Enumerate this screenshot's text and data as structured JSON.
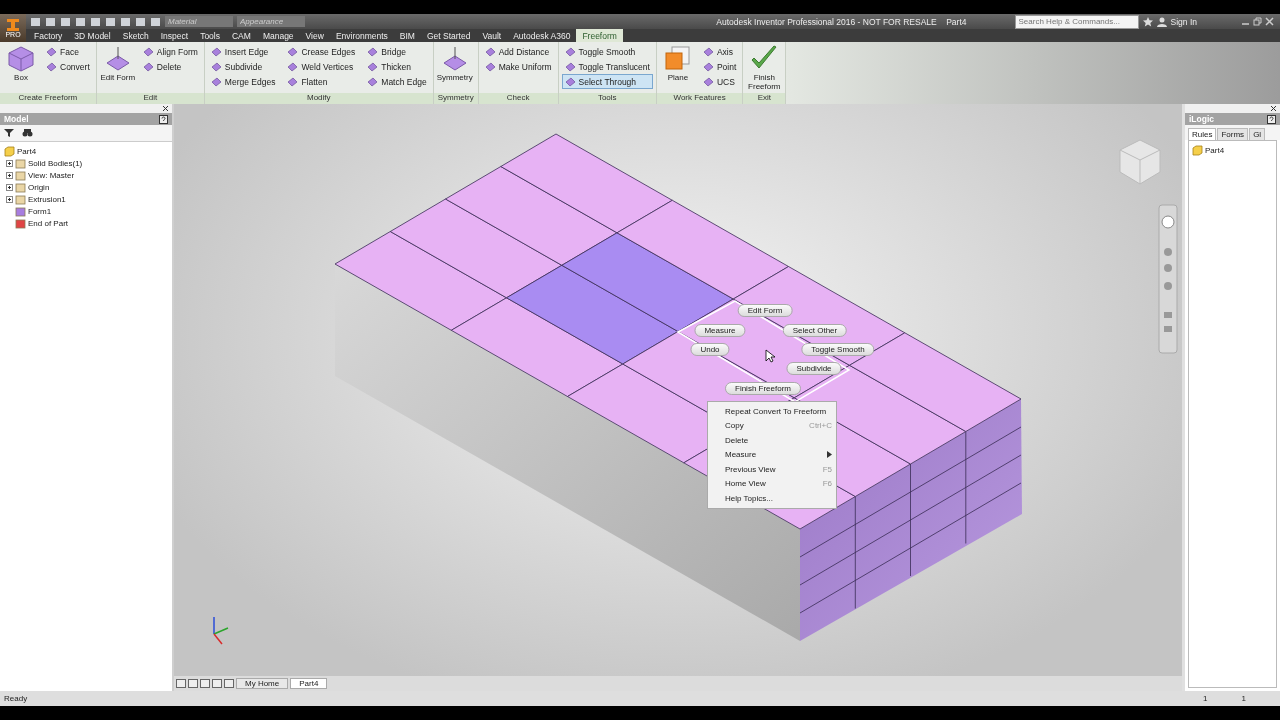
{
  "title_bar": {
    "app_badge": "PRO",
    "material": {
      "placeholder": "Material"
    },
    "appearance": {
      "placeholder": "Appearance"
    },
    "title": "Autodesk Inventor Professional 2016 - NOT FOR RESALE    Part4",
    "search": {
      "placeholder": "Search Help & Commands..."
    },
    "sign_in": "Sign In"
  },
  "menu_tabs": [
    {
      "label": "Factory",
      "selected": false
    },
    {
      "label": "3D Model",
      "selected": false
    },
    {
      "label": "Sketch",
      "selected": false
    },
    {
      "label": "Inspect",
      "selected": false
    },
    {
      "label": "Tools",
      "selected": false
    },
    {
      "label": "CAM",
      "selected": false
    },
    {
      "label": "Manage",
      "selected": false
    },
    {
      "label": "View",
      "selected": false
    },
    {
      "label": "Environments",
      "selected": false
    },
    {
      "label": "BIM",
      "selected": false
    },
    {
      "label": "Get Started",
      "selected": false
    },
    {
      "label": "Vault",
      "selected": false
    },
    {
      "label": "Autodesk A360",
      "selected": false
    },
    {
      "label": "Freeform",
      "selected": true
    }
  ],
  "ribbon_groups": [
    {
      "label": "Create Freeform",
      "tools": [
        {
          "label": "Box",
          "kind": "large",
          "selected": false
        },
        {
          "label": "Face",
          "kind": "small",
          "selected": false
        },
        {
          "label": "Convert",
          "kind": "small",
          "selected": false
        }
      ]
    },
    {
      "label": "Edit",
      "tools": [
        {
          "label": "Edit Form",
          "kind": "large",
          "selected": false
        },
        {
          "label": "Align Form",
          "kind": "small",
          "selected": false
        },
        {
          "label": "Delete",
          "kind": "small",
          "selected": false
        }
      ]
    },
    {
      "label": "Modify",
      "tools": [
        {
          "label": "Insert Edge",
          "kind": "small",
          "selected": false
        },
        {
          "label": "Subdivide",
          "kind": "small",
          "selected": false
        },
        {
          "label": "Merge Edges",
          "kind": "small",
          "selected": false
        },
        {
          "label": "Crease Edges",
          "kind": "small",
          "selected": false
        },
        {
          "label": "Weld Vertices",
          "kind": "small",
          "selected": false
        },
        {
          "label": "Flatten",
          "kind": "small",
          "selected": false
        },
        {
          "label": "Bridge",
          "kind": "small",
          "selected": false
        },
        {
          "label": "Thicken",
          "kind": "small",
          "selected": false
        },
        {
          "label": "Match Edge",
          "kind": "small",
          "selected": false
        }
      ]
    },
    {
      "label": "Symmetry",
      "tools": [
        {
          "label": "Symmetry",
          "kind": "large",
          "selected": false
        }
      ]
    },
    {
      "label": "Check",
      "tools": [
        {
          "label": "Add Distance",
          "kind": "small",
          "selected": false
        },
        {
          "label": "Make Uniform",
          "kind": "small",
          "selected": false
        }
      ]
    },
    {
      "label": "Tools",
      "tools": [
        {
          "label": "Toggle Smooth",
          "kind": "small",
          "selected": false
        },
        {
          "label": "Toggle Translucent",
          "kind": "small",
          "selected": false
        },
        {
          "label": "Select Through",
          "kind": "small",
          "selected": true
        }
      ]
    },
    {
      "label": "Work Features",
      "tools": [
        {
          "label": "Plane",
          "kind": "large",
          "selected": false
        },
        {
          "label": "Axis",
          "kind": "small",
          "selected": false
        },
        {
          "label": "Point",
          "kind": "small",
          "selected": false
        },
        {
          "label": "UCS",
          "kind": "small",
          "selected": false
        }
      ]
    },
    {
      "label": "Exit",
      "tools": [
        {
          "label": "Finish Freeform",
          "kind": "large",
          "selected": false
        }
      ]
    }
  ],
  "model_browser": {
    "title": "Model",
    "tree": [
      {
        "label": "Part4",
        "children": [
          {
            "label": "Solid Bodies(1)",
            "kind": "collapsed"
          },
          {
            "label": "View: Master",
            "kind": "collapsed"
          },
          {
            "label": "Origin",
            "kind": "collapsed"
          },
          {
            "label": "Extrusion1",
            "kind": "collapsed"
          },
          {
            "label": "Form1",
            "kind": "leaf"
          },
          {
            "label": "End of Part",
            "kind": "leaf"
          }
        ]
      }
    ]
  },
  "marking_menu": [
    "Edit Form",
    "Measure",
    "Select Other",
    "Undo",
    "Toggle Smooth",
    "Subdivide",
    "Finish Freeform"
  ],
  "context_menu": [
    {
      "label": "Repeat Convert To Freeform",
      "submenu": false
    },
    {
      "label": "Copy",
      "shortcut": "Ctrl+C",
      "submenu": false
    },
    {
      "label": "Delete",
      "submenu": false
    },
    {
      "label": "Measure",
      "submenu": true
    },
    {
      "label": "Previous View",
      "shortcut": "F5",
      "submenu": false
    },
    {
      "label": "Home View",
      "shortcut": "F6",
      "submenu": false
    },
    {
      "label": "Help Topics...",
      "submenu": false
    }
  ],
  "document_tabs": [
    {
      "label": "My Home",
      "selected": false
    },
    {
      "label": "Part4",
      "selected": true
    }
  ],
  "ilogic": {
    "title": "iLogic",
    "tabs": [
      {
        "label": "Rules",
        "selected": true
      },
      {
        "label": "Forms",
        "selected": false
      },
      {
        "label": "Gl",
        "selected": false
      }
    ],
    "items": [
      "Part4"
    ]
  },
  "status_bar": {
    "text": "Ready",
    "counters": [
      "1",
      "1"
    ]
  }
}
